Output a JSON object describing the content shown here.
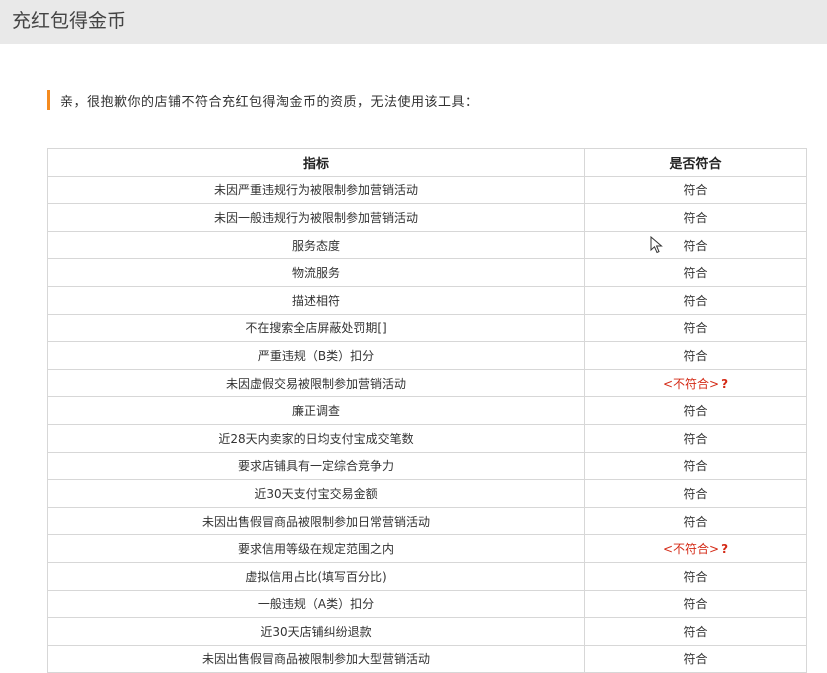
{
  "header": {
    "title": "充红包得金币"
  },
  "notice": {
    "text": "亲，很抱歉你的店铺不符合充红包得淘金币的资质，无法使用该工具："
  },
  "table": {
    "columns": [
      "指标",
      "是否符合"
    ],
    "rows": [
      {
        "criterion": "未因严重违规行为被限制参加营销活动",
        "status": "符合",
        "pass": true
      },
      {
        "criterion": "未因一般违规行为被限制参加营销活动",
        "status": "符合",
        "pass": true
      },
      {
        "criterion": "服务态度",
        "status": "符合",
        "pass": true
      },
      {
        "criterion": "物流服务",
        "status": "符合",
        "pass": true
      },
      {
        "criterion": "描述相符",
        "status": "符合",
        "pass": true
      },
      {
        "criterion": "不在搜索全店屏蔽处罚期[]",
        "status": "符合",
        "pass": true
      },
      {
        "criterion": "严重违规（B类）扣分",
        "status": "符合",
        "pass": true
      },
      {
        "criterion": "未因虚假交易被限制参加营销活动",
        "status": "<不符合>",
        "help": "?",
        "pass": false
      },
      {
        "criterion": "廉正调查",
        "status": "符合",
        "pass": true
      },
      {
        "criterion": "近28天内卖家的日均支付宝成交笔数",
        "status": "符合",
        "pass": true
      },
      {
        "criterion": "要求店铺具有一定综合竞争力",
        "status": "符合",
        "pass": true
      },
      {
        "criterion": "近30天支付宝交易金额",
        "status": "符合",
        "pass": true
      },
      {
        "criterion": "未因出售假冒商品被限制参加日常营销活动",
        "status": "符合",
        "pass": true
      },
      {
        "criterion": "要求信用等级在规定范围之内",
        "status": "<不符合>",
        "help": "?",
        "pass": false
      },
      {
        "criterion": "虚拟信用占比(填写百分比)",
        "status": "符合",
        "pass": true
      },
      {
        "criterion": "一般违规（A类）扣分",
        "status": "符合",
        "pass": true
      },
      {
        "criterion": "近30天店铺纠纷退款",
        "status": "符合",
        "pass": true
      },
      {
        "criterion": "未因出售假冒商品被限制参加大型营销活动",
        "status": "符合",
        "pass": true
      }
    ]
  },
  "colors": {
    "accent": "#f58b1f",
    "fail": "#d42a16",
    "header_bg": "#e9e9e9",
    "border": "#d7d7d7"
  },
  "icons": {
    "cursor": "mouse-pointer-icon"
  }
}
